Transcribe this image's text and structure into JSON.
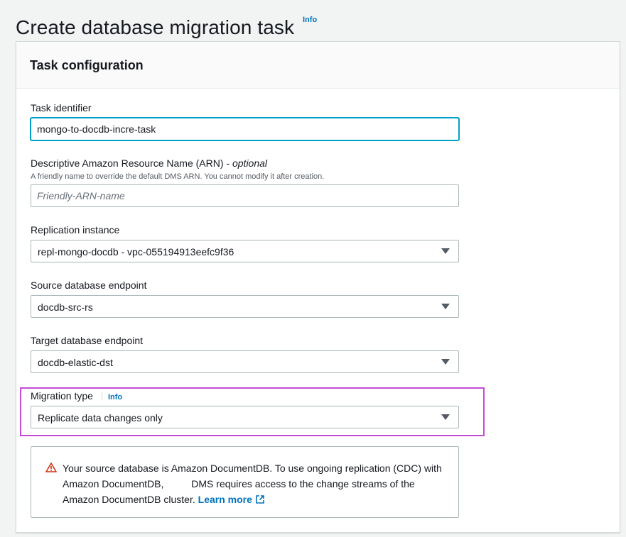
{
  "page": {
    "title": "Create database migration task",
    "info_label": "Info"
  },
  "panel": {
    "title": "Task configuration"
  },
  "fields": {
    "task_identifier": {
      "label": "Task identifier",
      "value": "mongo-to-docdb-incre-task"
    },
    "arn": {
      "label": "Descriptive Amazon Resource Name (ARN) - ",
      "optional": "optional",
      "description": "A friendly name to override the default DMS ARN. You cannot modify it after creation.",
      "placeholder": "Friendly-ARN-name"
    },
    "replication_instance": {
      "label": "Replication instance",
      "value": "repl-mongo-docdb - vpc-055194913eefc9f36"
    },
    "source_endpoint": {
      "label": "Source database endpoint",
      "value": "docdb-src-rs"
    },
    "target_endpoint": {
      "label": "Target database endpoint",
      "value": "docdb-elastic-dst"
    },
    "migration_type": {
      "label": "Migration type",
      "info_label": "Info",
      "value": "Replicate data changes only"
    }
  },
  "alert": {
    "icon": "warning-icon",
    "text": "Your source database is Amazon DocumentDB. To use ongoing replication (CDC) with Amazon DocumentDB,          DMS requires access to the change streams of the Amazon DocumentDB cluster. ",
    "link_label": "Learn more",
    "link_icon": "external-link-icon"
  },
  "colors": {
    "accent_link": "#0073bb",
    "focus_border": "#00a1c9",
    "highlight_border": "#c34dd6",
    "warning": "#d13212"
  }
}
